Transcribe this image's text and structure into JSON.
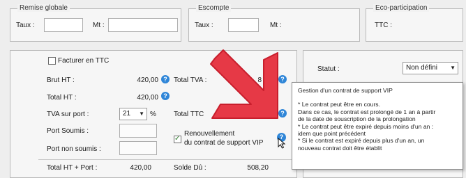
{
  "remise": {
    "legend": "Remise globale",
    "taux_label": "Taux :",
    "mt_label": "Mt :"
  },
  "escompte": {
    "legend": "Escompte",
    "taux_label": "Taux :",
    "mt_label": "Mt :"
  },
  "eco": {
    "legend": "Eco-participation",
    "ttc_label": "TTC :"
  },
  "totals": {
    "facturer_ttc_label": "Facturer en TTC",
    "brut_ht_label": "Brut HT :",
    "brut_ht_value": "420,00",
    "total_ht_label": "Total HT :",
    "total_ht_value": "420,00",
    "total_tva_label": "Total TVA :",
    "total_tva_value_partial": "8",
    "tva_port_label": "TVA sur port :",
    "tva_port_value": "21",
    "percent": "%",
    "total_ttc_label_partial": "Total TTC",
    "port_soumis_label": "Port Soumis :",
    "port_non_soumis_label": "Port non soumis :",
    "renouvellement_label_1": "Renouvellement",
    "renouvellement_label_2": "du contrat de support VIP",
    "total_ht_port_label": "Total HT + Port :",
    "total_ht_port_value": "420,00",
    "solde_du_label": "Solde Dû :",
    "solde_du_value": "508,20"
  },
  "statut": {
    "label": "Statut :",
    "value": "Non défini"
  },
  "tooltip": {
    "title": "Gestion d'un contrat de support VIP",
    "lines": [
      "* Le contrat peut être en cours.",
      "Dans ce cas, le contrat est prolongé de 1 an à partir",
      "de la date de souscription de la prolongation",
      "* Le contrat peut être expiré depuis moins d'un an :",
      "idem que point précédent",
      "* Si le contrat est expiré depuis plus d'un an, un",
      "nouveau contrat doit être établit"
    ]
  },
  "colors": {
    "accent_arrow": "#e63946",
    "help_icon": "#2f86d8"
  },
  "icons": {
    "help": "?",
    "dropdown": "▼",
    "arrow": "red-diagonal-arrow-icon",
    "cursor": "mouse-pointer-icon"
  }
}
